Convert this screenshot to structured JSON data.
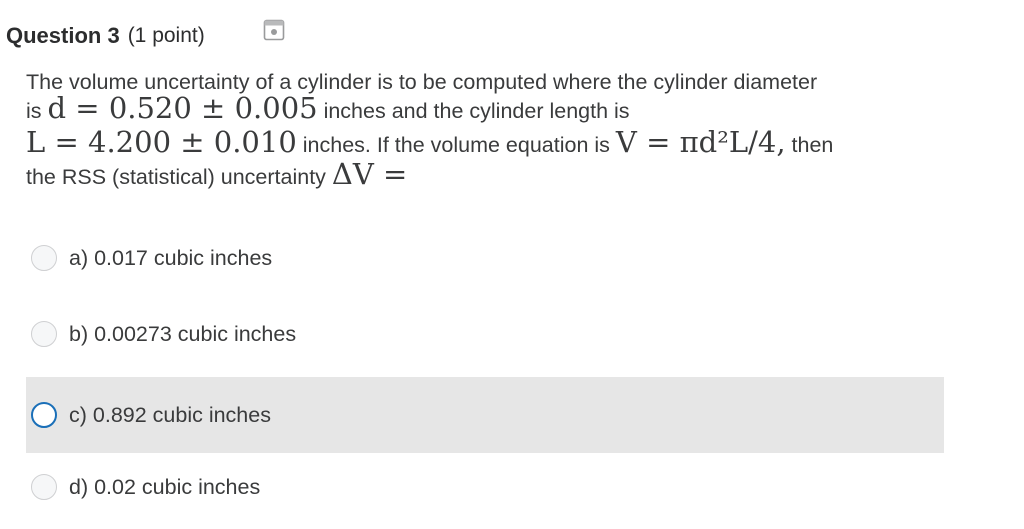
{
  "question": {
    "title": "Question 3",
    "points": "(1 point)",
    "save_icon": "save-icon",
    "stem": {
      "line1": "The volume uncertainty of a cylinder is to be computed where the cylinder diameter",
      "line2_prefix": "is",
      "line2_math": "d = 0.520 ± 0.005",
      "line2_suffix": "inches and the cylinder length is",
      "line3_math": "L = 4.200 ± 0.010",
      "line3_mid": "inches. If the volume equation is",
      "line3_math2": "V = πd²L/4,",
      "line3_suffix": "then",
      "line4_prefix": "the RSS (statistical) uncertainty",
      "line4_math": "ΔV ="
    }
  },
  "options": [
    {
      "label": "a) 0.017 cubic inches",
      "state": "unselected"
    },
    {
      "label": "b) 0.00273 cubic inches",
      "state": "unselected"
    },
    {
      "label": "c) 0.892 cubic inches",
      "state": "hovered"
    },
    {
      "label": "d) 0.02 cubic inches",
      "state": "unselected"
    }
  ],
  "colors": {
    "focus_ring": "#1a6fb8",
    "hover_background": "#e6e6e6"
  }
}
